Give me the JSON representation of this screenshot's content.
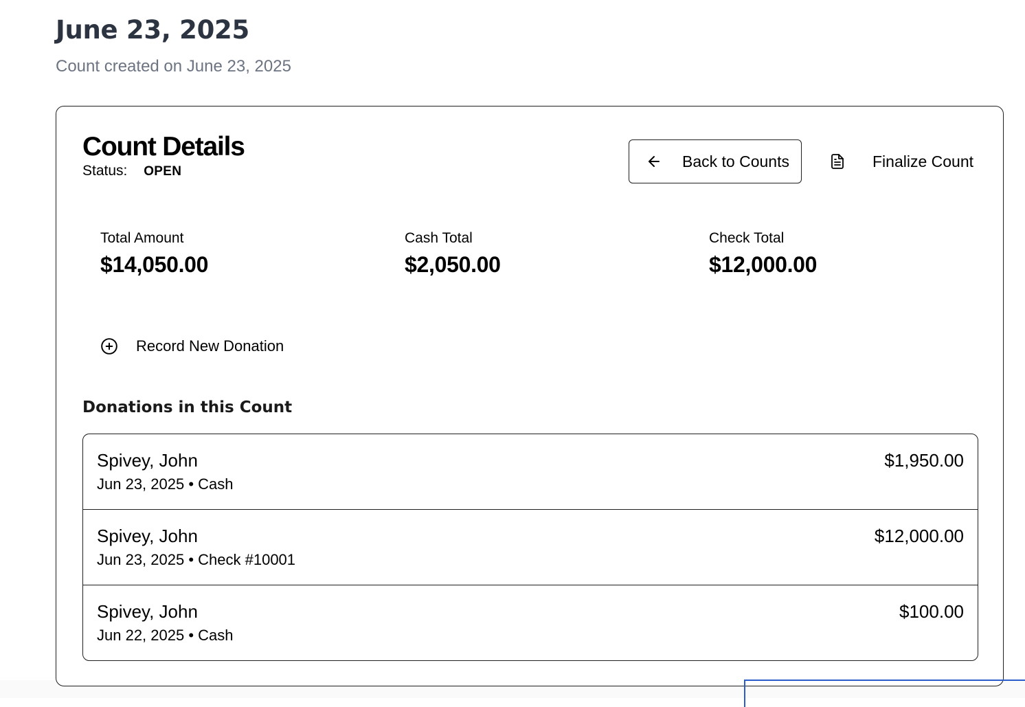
{
  "page": {
    "title": "June 23, 2025",
    "subtitle": "Count created on June 23, 2025"
  },
  "card": {
    "title": "Count Details",
    "status_label": "Status:",
    "status_value": "OPEN",
    "back_button_label": "Back to Counts",
    "back_button_icon": "arrow-left-icon",
    "finalize_button_label": "Finalize Count",
    "finalize_button_icon": "document-icon"
  },
  "stats": [
    {
      "label": "Total Amount",
      "value": "$14,050.00"
    },
    {
      "label": "Cash Total",
      "value": "$2,050.00"
    },
    {
      "label": "Check Total",
      "value": "$12,000.00"
    }
  ],
  "record_button": {
    "label": "Record New Donation",
    "icon": "plus-circle-icon"
  },
  "donations_section": {
    "title": "Donations in this Count",
    "items": [
      {
        "donor": "Spivey, John",
        "meta": "Jun 23, 2025 • Cash",
        "amount": "$1,950.00"
      },
      {
        "donor": "Spivey, John",
        "meta": "Jun 23, 2025 • Check #10001",
        "amount": "$12,000.00"
      },
      {
        "donor": "Spivey, John",
        "meta": "Jun 22, 2025 • Cash",
        "amount": "$100.00"
      }
    ]
  },
  "colors": {
    "title_text": "#2c3442",
    "subtitle_text": "#6c7381",
    "border": "#1f1f1f",
    "overlay_accent": "#2a5dc9"
  }
}
